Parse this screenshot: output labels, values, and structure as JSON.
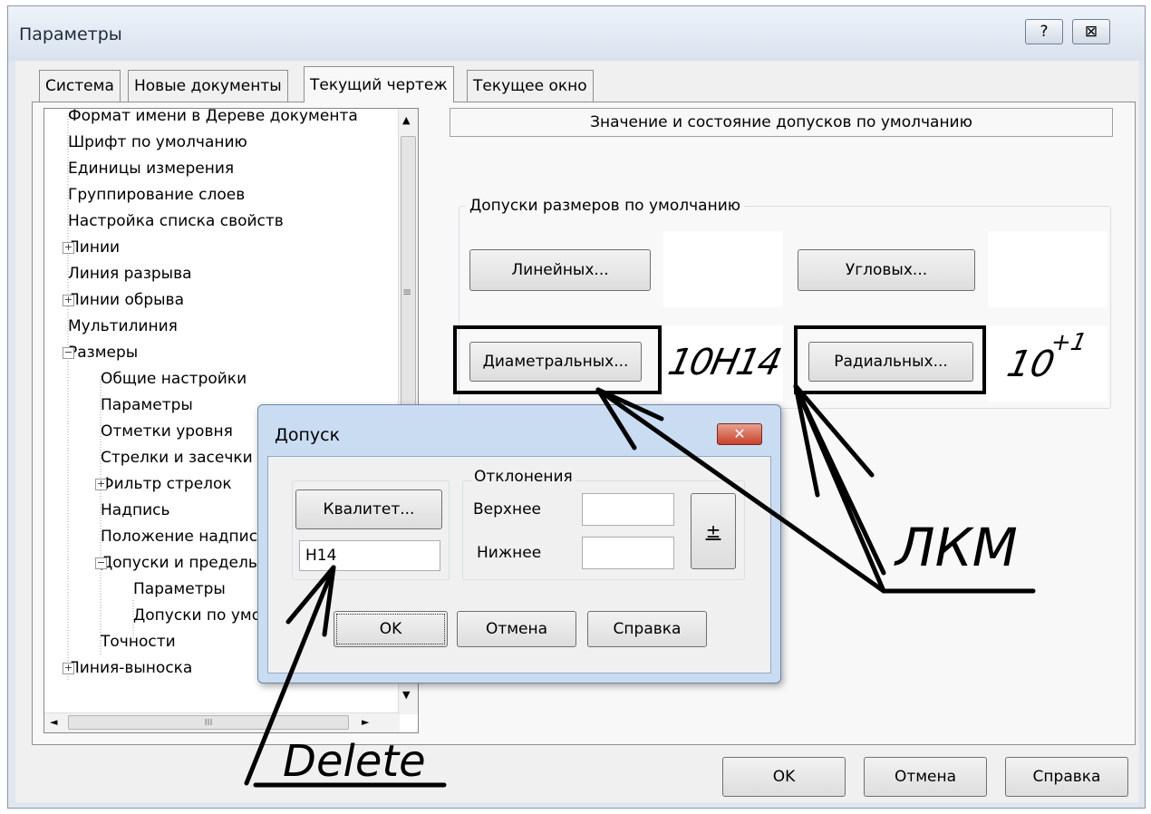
{
  "window": {
    "title": "Параметры",
    "help_glyph": "?",
    "close_glyph": "⊠"
  },
  "tabs": [
    "Система",
    "Новые документы",
    "Текущий чертеж",
    "Текущее окно"
  ],
  "tree": {
    "items": [
      "Формат имени в Дереве документа",
      "Шрифт по умолчанию",
      "Единицы измерения",
      "Группирование слоев",
      "Настройка списка свойств",
      "Линии",
      "Линия разрыва",
      "Линии обрыва",
      "Мультилиния",
      "Размеры",
      "Общие настройки",
      "Параметры",
      "Отметки уровня",
      "Стрелки и засечки",
      "Фильтр стрелок",
      "Надпись",
      "Положение надписи",
      "Допуски и предельные",
      "Параметры",
      "Допуски по умолчанию",
      "Точности",
      "Линия-выноска"
    ],
    "hscroll_thumb": "III"
  },
  "panel": {
    "header": "Значение и состояние допусков по умолчанию",
    "group_label": "Допуски размеров по умолчанию",
    "btn_linear": "Линейных...",
    "btn_angular": "Угловых...",
    "btn_diametral": "Диаметральных...",
    "btn_radial": "Радиальных...",
    "preview_diametral": "10H14",
    "preview_radial_base": "10",
    "preview_radial_sup": "+1"
  },
  "footer": {
    "ok": "OK",
    "cancel": "Отмена",
    "help": "Справка"
  },
  "dialog": {
    "title": "Допуск",
    "close_glyph": "✕",
    "btn_qualitet": "Квалитет...",
    "qualitet_value": "H14",
    "deviations_label": "Отклонения",
    "upper_label": "Верхнее",
    "lower_label": "Нижнее",
    "upper_value": "",
    "lower_value": "",
    "plusminus": "±",
    "ok": "OK",
    "cancel": "Отмена",
    "help": "Справка"
  },
  "annotations": {
    "lkm": "ЛКМ",
    "delete": "Delete"
  }
}
